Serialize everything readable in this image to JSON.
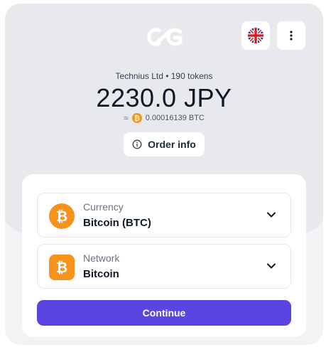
{
  "header": {
    "logo_icon": "cg-logo-icon",
    "language_icon": "uk-flag-icon",
    "menu_icon": "more-vertical-icon"
  },
  "payment": {
    "merchant_line": "Technius Ltd • 190 tokens",
    "amount": "2230.0 JPY",
    "approx_symbol": "≈",
    "crypto_amount": "0.00016139 BTC",
    "order_info_label": "Order info",
    "order_info_icon": "info-icon"
  },
  "form": {
    "currency": {
      "label": "Currency",
      "value": "Bitcoin (BTC)",
      "icon": "bitcoin-icon"
    },
    "network": {
      "label": "Network",
      "value": "Bitcoin",
      "icon": "bitcoin-icon"
    },
    "continue_label": "Continue"
  },
  "colors": {
    "accent": "#5b45e0",
    "bitcoin": "#f7931a",
    "background_top": "#e8e9ec",
    "card": "#ffffff"
  }
}
